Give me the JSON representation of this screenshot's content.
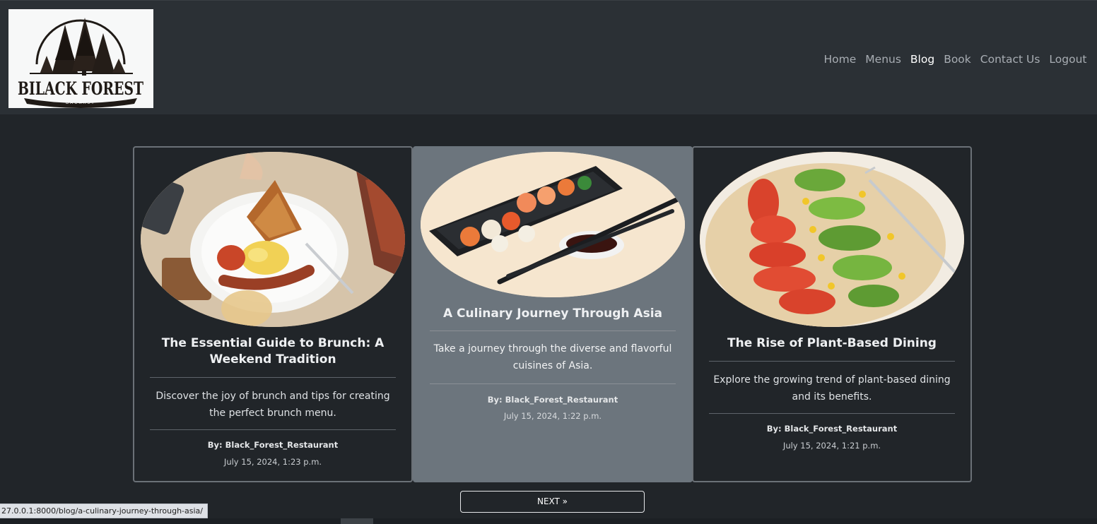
{
  "logo": {
    "text": "BILACK FOREST",
    "subtext": "BACKRST",
    "colors": {
      "ink": "#1f1a16",
      "bg": "#f7f8f8"
    }
  },
  "nav": {
    "items": [
      {
        "label": "Home",
        "active": false
      },
      {
        "label": "Menus",
        "active": false
      },
      {
        "label": "Blog",
        "active": true
      },
      {
        "label": "Book",
        "active": false
      },
      {
        "label": "Contact Us",
        "active": false
      },
      {
        "label": "Logout",
        "active": false
      }
    ]
  },
  "posts": [
    {
      "title": "The Essential Guide to Brunch: A Weekend Tradition",
      "excerpt": "Discover the joy of brunch and tips for creating the perfect brunch menu.",
      "author": "By: Black_Forest_Restaurant",
      "date": "July 15, 2024, 1:23 p.m.",
      "image": "brunch-plate-image",
      "hover": false
    },
    {
      "title": "A Culinary Journey Through Asia",
      "excerpt": "Take a journey through the diverse and flavorful cuisines of Asia.",
      "author": "By: Black_Forest_Restaurant",
      "date": "July 15, 2024, 1:22 p.m.",
      "image": "sushi-tray-image",
      "hover": true
    },
    {
      "title": "The Rise of Plant-Based Dining",
      "excerpt": "Explore the growing trend of plant-based dining and its benefits.",
      "author": "By: Black_Forest_Restaurant",
      "date": "July 15, 2024, 1:21 p.m.",
      "image": "plant-wrap-image",
      "hover": false
    }
  ],
  "pagination": {
    "next_label": "NEXT »"
  },
  "status": {
    "url": "27.0.0.1:8000/blog/a-culinary-journey-through-asia/"
  },
  "colors": {
    "page_bg": "#212529",
    "navbar_bg": "#2b3035",
    "card_hover_bg": "#6c757d",
    "card_border": "#6b7177"
  }
}
